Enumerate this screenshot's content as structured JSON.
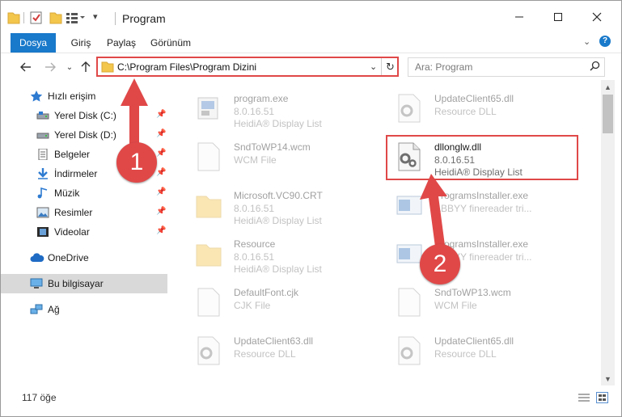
{
  "window": {
    "title": "Program",
    "controls": [
      "minimize-icon",
      "maximize-icon",
      "close-icon"
    ]
  },
  "ribbon": {
    "tabs": [
      "Dosya",
      "Giriş",
      "Paylaş",
      "Görünüm"
    ]
  },
  "navbar": {
    "address": "C:\\Program Files\\Program Dizini",
    "search_placeholder": "Ara: Program"
  },
  "sidebar": {
    "items": [
      {
        "label": "Hızlı erişim",
        "icon": "star-icon"
      },
      {
        "label": "Yerel Disk (C:)",
        "icon": "drive-icon"
      },
      {
        "label": "Yerel Disk (D:)",
        "icon": "drive-icon"
      },
      {
        "label": "Belgeler",
        "icon": "documents-icon"
      },
      {
        "label": "İndirmeler",
        "icon": "download-icon"
      },
      {
        "label": "Müzik",
        "icon": "music-icon"
      },
      {
        "label": "Resimler",
        "icon": "pictures-icon"
      },
      {
        "label": "Videolar",
        "icon": "video-icon"
      },
      {
        "label": "OneDrive",
        "icon": "cloud-icon"
      },
      {
        "label": "Bu bilgisayar",
        "icon": "computer-icon"
      },
      {
        "label": "Ağ",
        "icon": "network-icon"
      }
    ]
  },
  "files": [
    {
      "name": "program.exe",
      "line2": "8.0.16.51",
      "line3": "HeidiA® Display List",
      "icon": "exe-icon"
    },
    {
      "name": "UpdateClient65.dll",
      "line2": "Resource DLL",
      "line3": "",
      "icon": "dll-icon"
    },
    {
      "name": "SndToWP14.wcm",
      "line2": "WCM File",
      "line3": "",
      "icon": "file-icon"
    },
    {
      "name": "dllonglw.dll",
      "line2": "8.0.16.51",
      "line3": "HeidiA® Display List",
      "icon": "dll-icon"
    },
    {
      "name": "Microsoft.VC90.CRT",
      "line2": "8.0.16.51",
      "line3": "HeidiA® Display List",
      "icon": "folder-icon"
    },
    {
      "name": "ProgramsInstaller.exe",
      "line2": "ABBYY finereader tri...",
      "line3": "",
      "icon": "installer-icon"
    },
    {
      "name": "Resource",
      "line2": "8.0.16.51",
      "line3": "HeidiA® Display List",
      "icon": "folder-icon"
    },
    {
      "name": "ProgramsInstaller.exe",
      "line2": "ABBYY finereader tri...",
      "line3": "",
      "icon": "installer-icon"
    },
    {
      "name": "DefaultFont.cjk",
      "line2": "CJK File",
      "line3": "",
      "icon": "file-icon"
    },
    {
      "name": "SndToWP13.wcm",
      "line2": "WCM File",
      "line3": "",
      "icon": "file-icon"
    },
    {
      "name": "UpdateClient63.dll",
      "line2": "Resource DLL",
      "line3": "",
      "icon": "dll-icon"
    },
    {
      "name": "UpdateClient65.dll",
      "line2": "Resource DLL",
      "line3": "",
      "icon": "dll-icon"
    }
  ],
  "status": {
    "item_count": "117 öğe"
  },
  "annotations": {
    "step1": "1",
    "step2": "2"
  },
  "colors": {
    "accent": "#1979ca",
    "highlight_red": "#e04848"
  }
}
